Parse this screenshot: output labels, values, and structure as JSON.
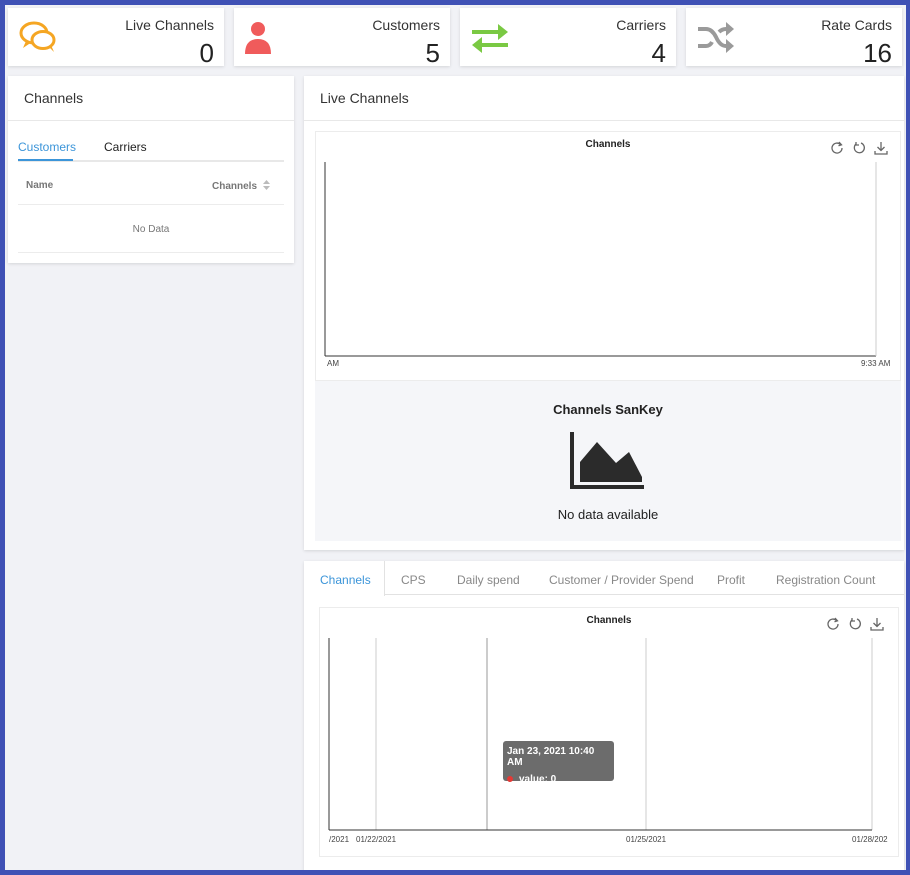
{
  "stats": [
    {
      "label": "Live Channels",
      "value": "0",
      "icon": "chat-bubbles-icon",
      "color": "#f5a623"
    },
    {
      "label": "Customers",
      "value": "5",
      "icon": "user-icon",
      "color": "#f05b5b"
    },
    {
      "label": "Carriers",
      "value": "4",
      "icon": "swap-arrows-icon",
      "color": "#7ac943"
    },
    {
      "label": "Rate Cards",
      "value": "16",
      "icon": "shuffle-icon",
      "color": "#9a9a9a"
    }
  ],
  "channels_card": {
    "title": "Channels",
    "tabs": [
      "Customers",
      "Carriers"
    ],
    "active_tab": "Customers",
    "columns": [
      "Name",
      "Channels"
    ],
    "empty_text": "No Data"
  },
  "live_channels": {
    "title": "Live Channels",
    "chart_title": "Channels",
    "x_start": "AM",
    "x_end": "9:33 AM",
    "sankey_title": "Channels SanKey",
    "sankey_empty": "No data available"
  },
  "bottom_tabs": [
    "Channels",
    "CPS",
    "Daily spend",
    "Customer / Provider Spend",
    "Profit",
    "Registration Count"
  ],
  "bottom_active_tab": "Channels",
  "bottom_chart": {
    "title": "Channels",
    "x_ticks": [
      "/2021",
      "01/22/2021",
      "01/25/2021",
      "01/28/202"
    ],
    "tooltip_date": "Jan 23, 2021 10:40 AM",
    "tooltip_value": "value: 0"
  },
  "colors": {
    "accent": "#3c95d9",
    "frame": "#3f51b5"
  },
  "chart_data": [
    {
      "type": "line",
      "title": "Channels",
      "x": [
        "AM",
        "9:33 AM"
      ],
      "series": []
    },
    {
      "type": "line",
      "title": "Channels",
      "x": [
        "/2021",
        "01/22/2021",
        "01/25/2021",
        "01/28/202"
      ],
      "series": [
        {
          "values": [
            0
          ]
        }
      ],
      "tooltip": {
        "x": "Jan 23, 2021 10:40 AM",
        "value": 0
      }
    }
  ]
}
